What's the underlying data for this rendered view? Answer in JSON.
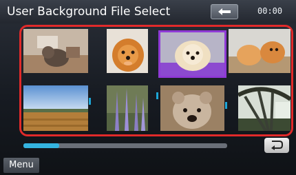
{
  "header": {
    "title": "User Background File Select",
    "clock": "00:00",
    "back_icon": "back-arrow-icon"
  },
  "colors": {
    "selection_frame": "#e12a2a",
    "selected_item": "#8f3ad6",
    "scroll_accent": "#34b4e0"
  },
  "thumbnails": [
    {
      "subject": "dog on indoor floor"
    },
    {
      "subject": "pomeranian face close-up"
    },
    {
      "subject": "pomeranian on purple blanket",
      "selected": true
    },
    {
      "subject": "dogs playing on floor"
    },
    {
      "subject": "field under blue sky"
    },
    {
      "subject": "purple flowers"
    },
    {
      "subject": "bulldog face close-up"
    },
    {
      "subject": "bridge in greenery"
    }
  ],
  "scroll": {
    "position_fraction": 0.0
  },
  "footer": {
    "menu_label": "Menu",
    "return_icon": "return-arrow-icon"
  }
}
